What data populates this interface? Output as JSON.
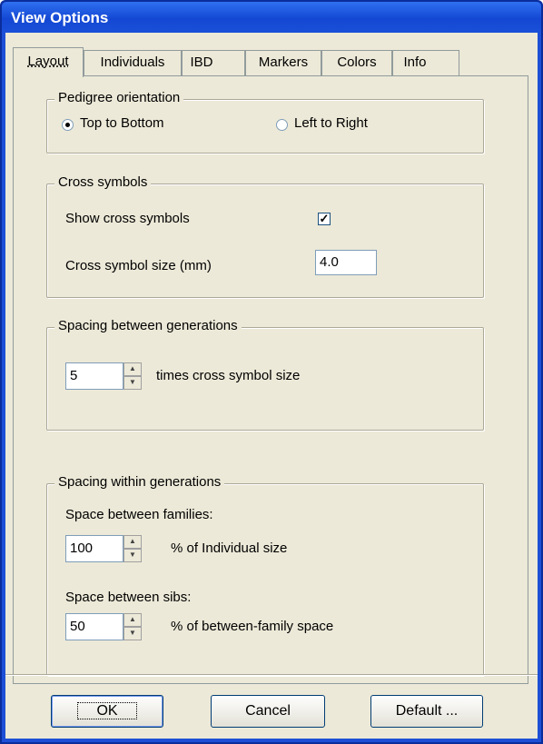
{
  "window": {
    "title": "View Options"
  },
  "tabs": [
    {
      "label": "Layout",
      "active": true
    },
    {
      "label": "Individuals",
      "active": false
    },
    {
      "label": "IBD",
      "active": false
    },
    {
      "label": "Markers",
      "active": false
    },
    {
      "label": "Colors",
      "active": false
    },
    {
      "label": "Info",
      "active": false
    }
  ],
  "orientation": {
    "legend": "Pedigree orientation",
    "option1": "Top to Bottom",
    "option2": "Left to Right",
    "selected": "Top to Bottom"
  },
  "cross": {
    "legend": "Cross symbols",
    "show_label": "Show cross symbols",
    "show_checked": true,
    "check_glyph": "✓",
    "size_label": "Cross symbol size (mm)",
    "size_value": "4.0"
  },
  "between": {
    "legend": "Spacing between generations",
    "value": "5",
    "suffix": "times cross symbol size"
  },
  "within": {
    "legend": "Spacing within generations",
    "families_label": "Space between families:",
    "families_value": "100",
    "families_suffix": "% of Individual size",
    "sibs_label": "Space between sibs:",
    "sibs_value": "50",
    "sibs_suffix": "% of between-family space"
  },
  "spinner": {
    "up_glyph": "▲",
    "down_glyph": "▼"
  },
  "buttons": {
    "ok": "OK",
    "cancel": "Cancel",
    "default": "Default ..."
  }
}
